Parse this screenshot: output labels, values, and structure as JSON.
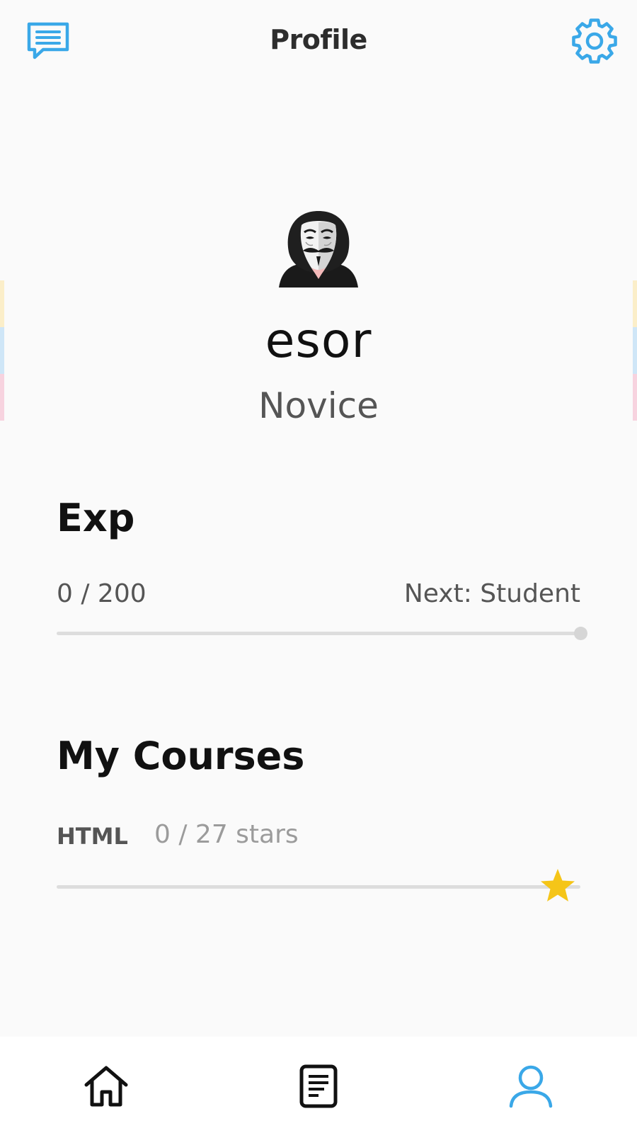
{
  "header": {
    "title": "Profile",
    "left_icon": "chat-icon",
    "right_icon": "gear-icon",
    "accent_color": "#3aa8e8"
  },
  "profile": {
    "username": "esor",
    "rank": "Novice",
    "avatar": "hooded-mask-avatar"
  },
  "exp": {
    "title": "Exp",
    "value_text": "0 / 200",
    "current": 0,
    "max": 200,
    "progress_fraction": 0,
    "next_text": "Next: Student"
  },
  "courses": {
    "title": "My Courses",
    "items": [
      {
        "name": "HTML",
        "stars_text": "0 / 27 stars",
        "stars": 0,
        "max_stars": 27,
        "progress_fraction": 0,
        "icon": "star-icon",
        "star_color": "#f5c518"
      }
    ]
  },
  "bottom_nav": {
    "items": [
      {
        "icon": "home-icon",
        "active": false
      },
      {
        "icon": "courses-icon",
        "active": false
      },
      {
        "icon": "profile-icon",
        "active": true
      }
    ],
    "active_color": "#3aa8e8"
  },
  "side_stripes": [
    "#fbeec9",
    "#cfe6f7",
    "#f7d3df"
  ]
}
